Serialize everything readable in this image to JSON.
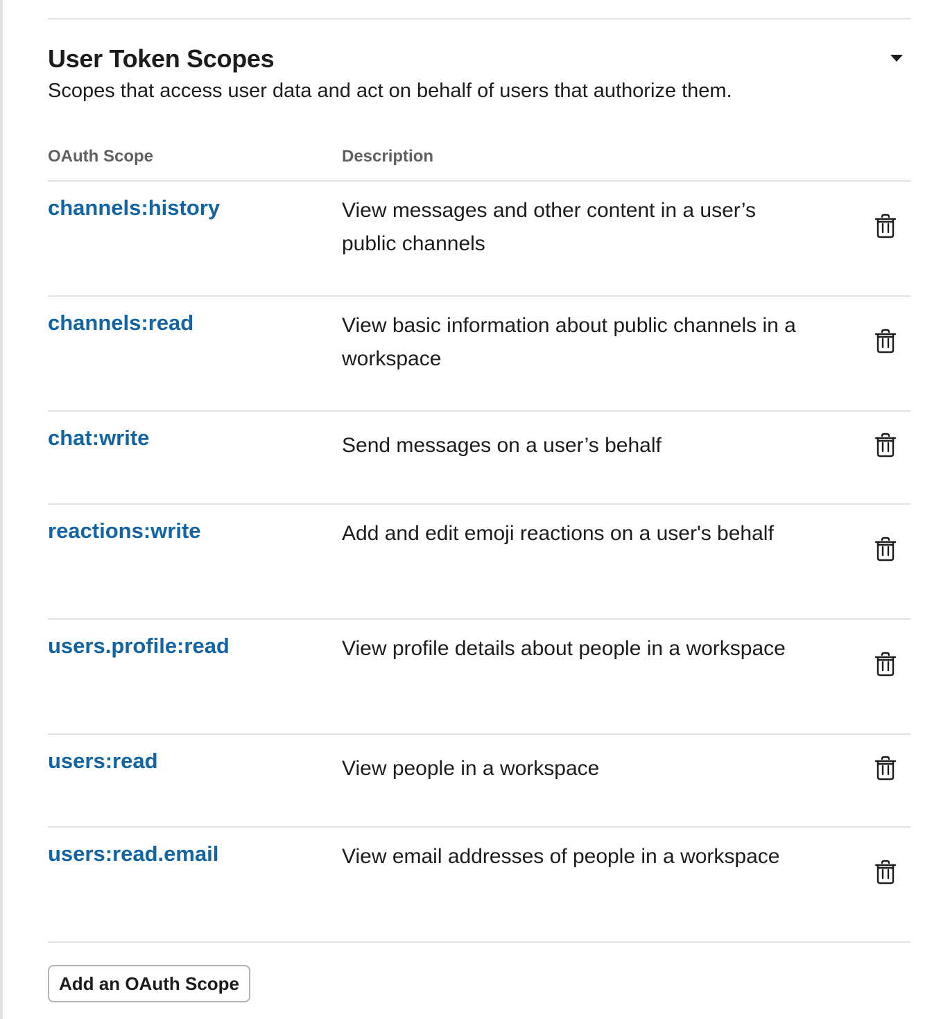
{
  "section": {
    "title": "User Token Scopes",
    "subtitle": "Scopes that access user data and act on behalf of users that authorize them.",
    "toggle_icon": "caret-down-icon"
  },
  "table": {
    "headers": {
      "scope": "OAuth Scope",
      "description": "Description"
    },
    "rows": [
      {
        "scope": "channels:history",
        "description": "View messages and other content in a user’s public channels"
      },
      {
        "scope": "channels:read",
        "description": "View basic information about public channels in a workspace"
      },
      {
        "scope": "chat:write",
        "description": "Send messages on a user’s behalf"
      },
      {
        "scope": "reactions:write",
        "description": "Add and edit emoji reactions on a user's behalf"
      },
      {
        "scope": "users.profile:read",
        "description": "View profile details about people in a workspace"
      },
      {
        "scope": "users:read",
        "description": "View people in a workspace"
      },
      {
        "scope": "users:read.email",
        "description": "View email addresses of people in a workspace"
      }
    ],
    "row_action_icon": "trash-icon"
  },
  "actions": {
    "add_scope_label": "Add an OAuth Scope"
  },
  "colors": {
    "link": "#1264a3",
    "text": "#1d1c1d",
    "muted": "#616061",
    "divider": "#e2e2e2"
  }
}
